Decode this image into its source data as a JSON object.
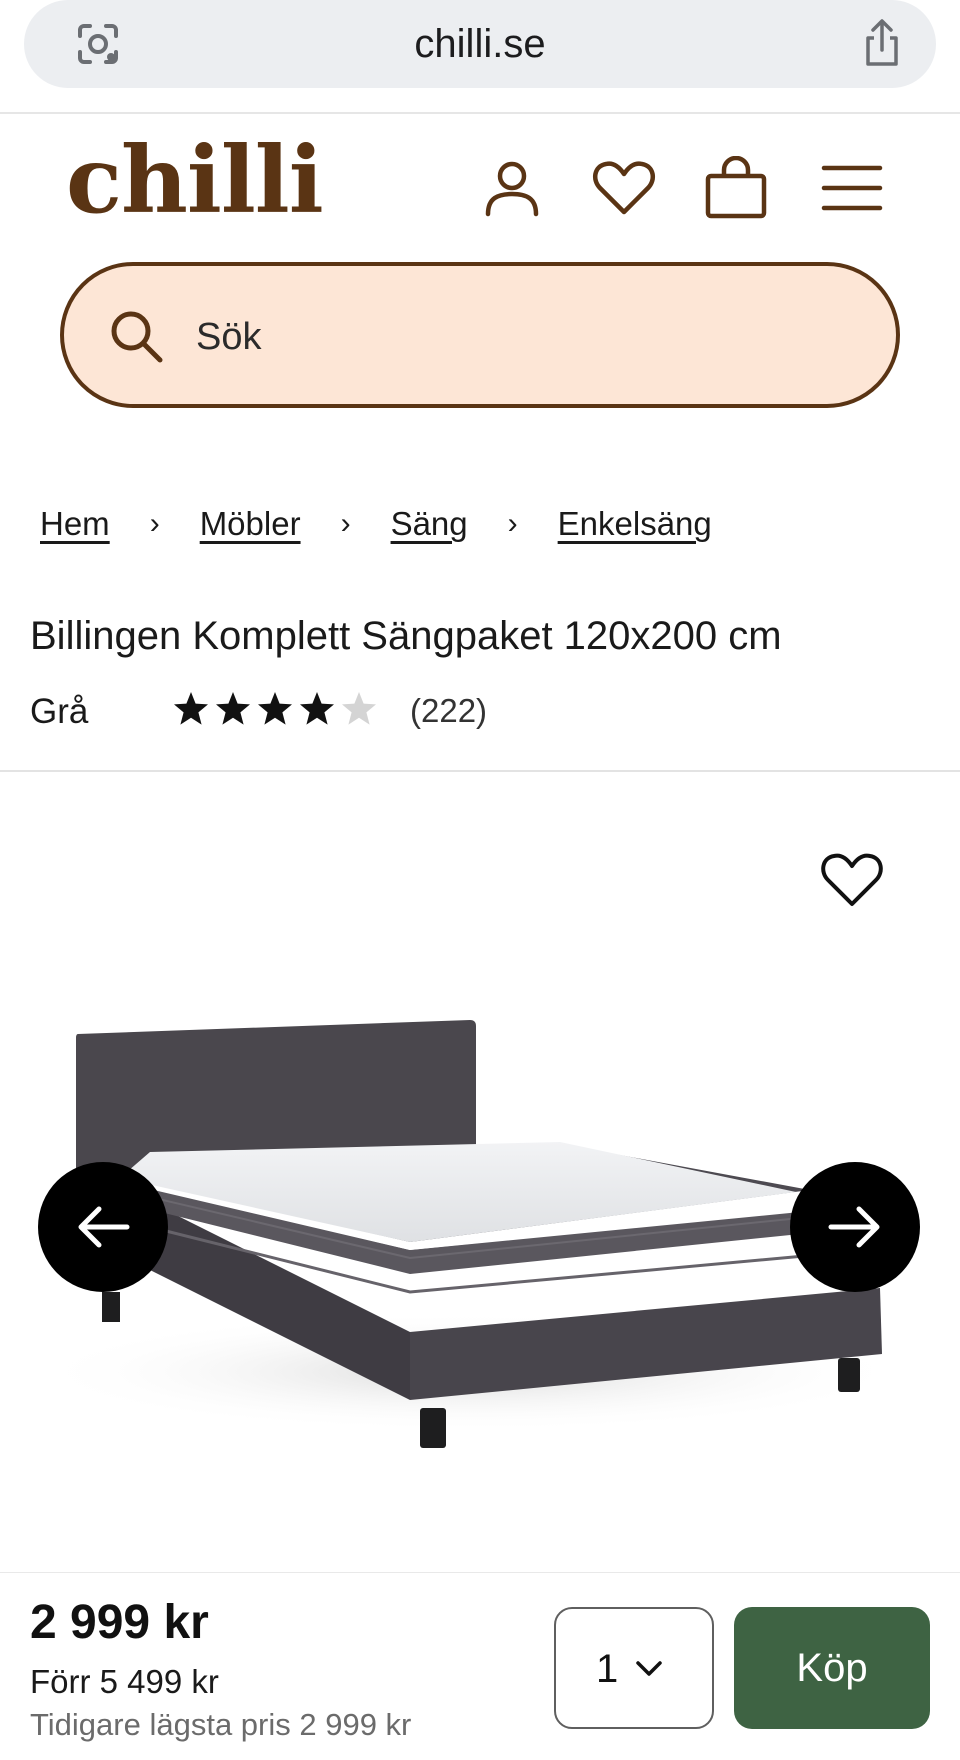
{
  "browser": {
    "url": "chilli.se",
    "icons": [
      "lens-icon",
      "share-icon"
    ]
  },
  "header": {
    "logo": "chilli",
    "brand_color": "#5a3414",
    "icons": [
      "user-icon",
      "heart-icon",
      "bag-icon",
      "menu-icon"
    ]
  },
  "search": {
    "placeholder": "Sök",
    "background": "#fde6d6"
  },
  "breadcrumb": {
    "items": [
      "Hem",
      "Möbler",
      "Säng",
      "Enkelsäng"
    ],
    "separator": "›"
  },
  "product": {
    "title": "Billingen Komplett Sängpaket 120x200 cm",
    "color": "Grå",
    "rating": 4,
    "rating_max": 5,
    "review_count": "(222)"
  },
  "gallery": {
    "icons": [
      "heart-icon",
      "arrow-left-icon",
      "arrow-right-icon"
    ]
  },
  "purchase": {
    "price": "2 999 kr",
    "previous_price": "Förr 5 499 kr",
    "lowest_price": "Tidigare lägsta pris 2 999 kr",
    "quantity": "1",
    "buy_label": "Köp",
    "buy_color": "#3e6343"
  }
}
